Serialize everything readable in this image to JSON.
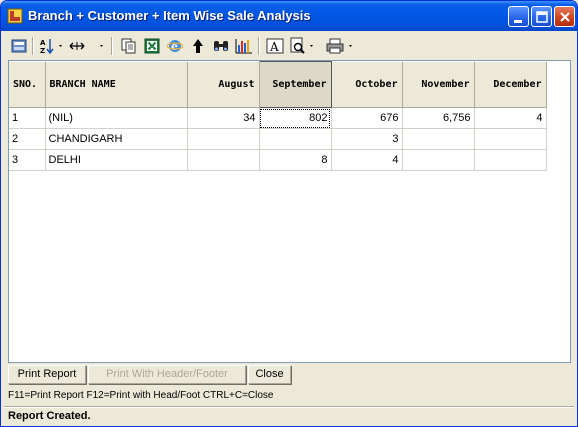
{
  "window": {
    "title": "Branch + Customer + Item Wise Sale Analysis"
  },
  "toolbar": {
    "icons": [
      "export-icon",
      "sort-icon",
      "column-width-icon",
      "copy-icon",
      "excel-icon",
      "browser-icon",
      "up-arrow-icon",
      "find-icon",
      "chart-icon",
      "font-icon",
      "print-preview-icon",
      "printer-icon"
    ]
  },
  "grid": {
    "columns": [
      "SNO.",
      "BRANCH NAME",
      "August",
      "September",
      "October",
      "November",
      "December"
    ],
    "rows": [
      {
        "sno": "1",
        "branch": "(NIL)",
        "august": "34",
        "september": "802",
        "october": "676",
        "november": "6,756",
        "december": "4"
      },
      {
        "sno": "2",
        "branch": "CHANDIGARH",
        "august": "",
        "september": "",
        "october": "3",
        "november": "",
        "december": ""
      },
      {
        "sno": "3",
        "branch": "DELHI",
        "august": "",
        "september": "8",
        "october": "4",
        "november": "",
        "december": ""
      }
    ]
  },
  "buttons": {
    "print_report": "Print Report",
    "print_header_footer": "Print With Header/Footer",
    "close": "Close"
  },
  "hint": "F11=Print Report  F12=Print with Head/Foot  CTRL+C=Close",
  "status": "Report Created.",
  "colors": {
    "titlebar": "#0058e6",
    "chrome": "#ece9d8",
    "close_button": "#d0411c"
  }
}
